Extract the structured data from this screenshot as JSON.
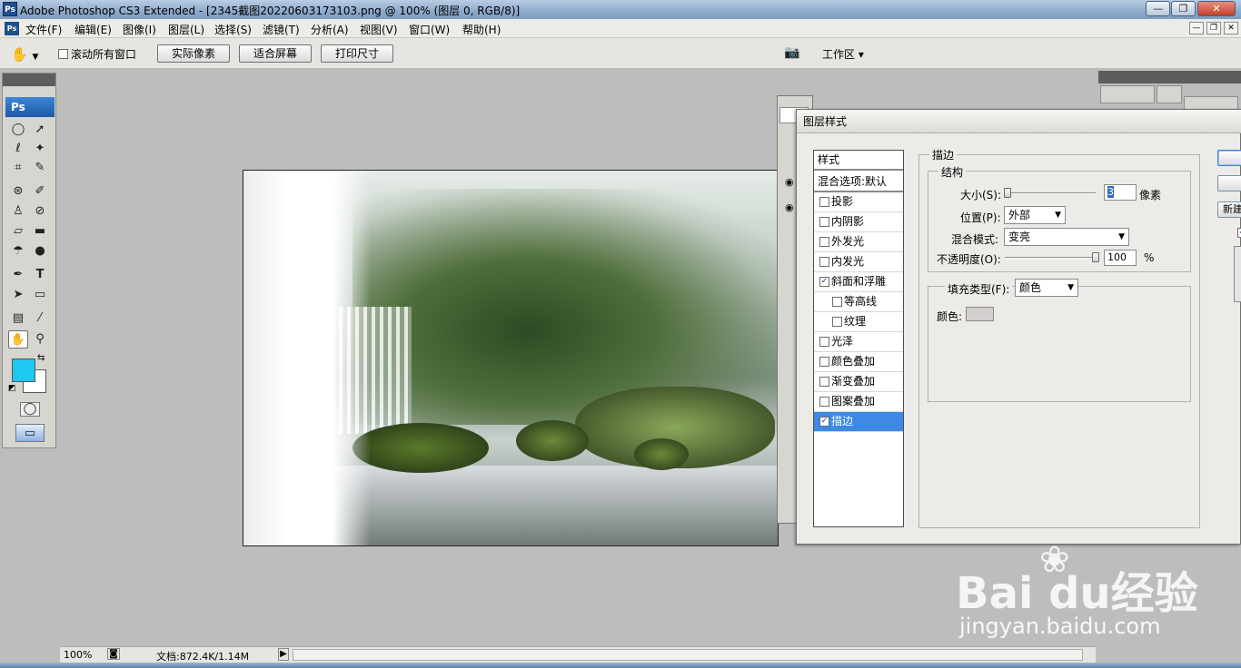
{
  "window": {
    "title": "Adobe Photoshop CS3 Extended - [2345截图20220603173103.png @ 100% (图层 0, RGB/8)]",
    "app_icon": "Ps",
    "controls": {
      "minimize": "—",
      "maximize": "❐",
      "close": "✕"
    }
  },
  "menu": {
    "items": [
      "文件(F)",
      "编辑(E)",
      "图像(I)",
      "图层(L)",
      "选择(S)",
      "滤镜(T)",
      "分析(A)",
      "视图(V)",
      "窗口(W)",
      "帮助(H)"
    ],
    "doc_controls": {
      "minimize": "—",
      "restore": "❐",
      "close": "✕"
    }
  },
  "options_bar": {
    "scroll_all_label": "滚动所有窗口",
    "scroll_all_checked": false,
    "actual_pixels": "实际像素",
    "fit_screen": "适合屏幕",
    "print_size": "打印尺寸",
    "workspace": "工作区 ▾"
  },
  "toolbox": {
    "logo": "Ps",
    "foreground_color": "#1ec8f0",
    "background_color": "#ffffff"
  },
  "status": {
    "zoom": "100%",
    "doc_size": "文档:872.4K/1.14M"
  },
  "dialog": {
    "title": "图层样式",
    "style_list": [
      {
        "label": "样式",
        "kind": "header"
      },
      {
        "label": "混合选项:默认",
        "kind": "header"
      },
      {
        "label": "投影",
        "checked": false
      },
      {
        "label": "内阴影",
        "checked": false
      },
      {
        "label": "外发光",
        "checked": false
      },
      {
        "label": "内发光",
        "checked": false
      },
      {
        "label": "斜面和浮雕",
        "checked": true
      },
      {
        "label": "等高线",
        "checked": false,
        "indent": true
      },
      {
        "label": "纹理",
        "checked": false,
        "indent": true
      },
      {
        "label": "光泽",
        "checked": false
      },
      {
        "label": "颜色叠加",
        "checked": false
      },
      {
        "label": "渐变叠加",
        "checked": false
      },
      {
        "label": "图案叠加",
        "checked": false
      },
      {
        "label": "描边",
        "checked": true,
        "selected": true
      }
    ],
    "stroke": {
      "group_title": "描边",
      "structure_title": "结构",
      "size_label": "大小(S):",
      "size_value": "3",
      "size_unit": "像素",
      "size_fraction": 0.01,
      "position_label": "位置(P):",
      "position_value": "外部",
      "blend_label": "混合模式:",
      "blend_value": "变亮",
      "opacity_label": "不透明度(O):",
      "opacity_value": "100",
      "opacity_unit": "%",
      "fill_type_label": "填充类型(F):",
      "fill_type_value": "颜色",
      "color_label": "颜色:",
      "color_value": "#d4d0d0"
    },
    "right_buttons": [
      "",
      "",
      "新建"
    ]
  },
  "watermark": {
    "brand": "Bai  du经验",
    "url": "jingyan.baidu.com"
  }
}
